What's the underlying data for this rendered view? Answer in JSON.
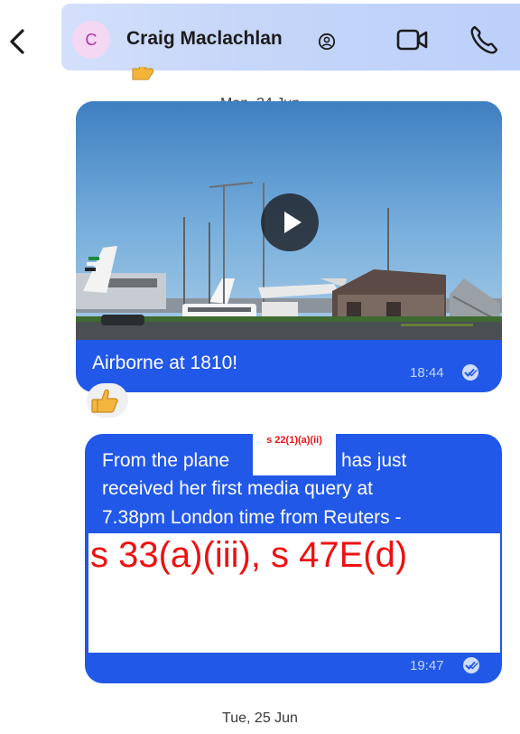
{
  "header": {
    "contact_name": "Craig Maclachlan",
    "avatar_initial": "C",
    "icons": [
      "back-chevron-icon",
      "verified-icon",
      "video-call-icon",
      "phone-icon"
    ]
  },
  "dates": {
    "first": "Mon, 24 Jun",
    "second": "Tue, 25 Jun"
  },
  "messages": [
    {
      "type": "video",
      "caption": "Airborne at 1810!",
      "time": "18:44",
      "status_icon": "read-receipt-icon",
      "reaction": "thumbs-up"
    },
    {
      "type": "text",
      "lines": [
        "From the plane",
        "has just",
        "received her first media query at",
        "7.38pm London time from Reuters -"
      ],
      "redaction_inline": "s 22(1)(a)(ii)",
      "redaction_block": "s 33(a)(iii), s 47E(d)",
      "time": "19:47",
      "status_icon": "read-receipt-icon"
    }
  ],
  "colors": {
    "bubble": "#2158e8",
    "header_bg": "#c6d6f9",
    "redaction_text": "#ee1111"
  }
}
